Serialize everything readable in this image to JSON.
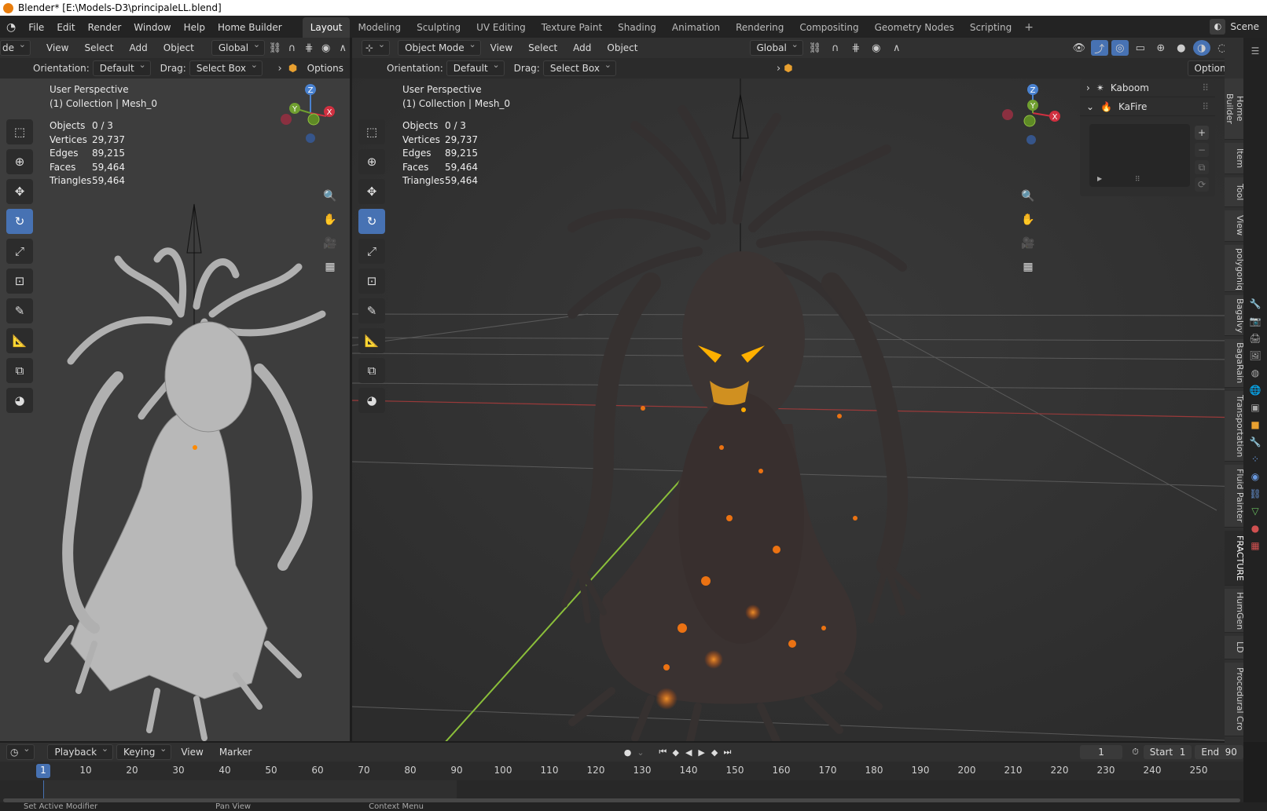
{
  "title": "Blender* [E:\\Models-D3\\principaleLL.blend]",
  "menu": [
    "File",
    "Edit",
    "Render",
    "Window",
    "Help",
    "Home Builder"
  ],
  "workspaces": [
    "Layout",
    "Modeling",
    "Sculpting",
    "UV Editing",
    "Texture Paint",
    "Shading",
    "Animation",
    "Rendering",
    "Compositing",
    "Geometry Nodes",
    "Scripting"
  ],
  "active_workspace": "Layout",
  "scene_label": "Scene",
  "left_view": {
    "mode_partial": "de",
    "menus": [
      "View",
      "Select",
      "Add",
      "Object"
    ],
    "transform": "Global",
    "orientation_label": "Orientation:",
    "orientation": "Default",
    "drag_label": "Drag:",
    "drag": "Select Box",
    "options": "Options",
    "perspective": "User Perspective",
    "collection": "(1) Collection | Mesh_0"
  },
  "right_view": {
    "mode": "Object Mode",
    "menus": [
      "View",
      "Select",
      "Add",
      "Object"
    ],
    "transform": "Global",
    "orientation_label": "Orientation:",
    "orientation": "Default",
    "drag_label": "Drag:",
    "drag": "Select Box",
    "options": "Options",
    "perspective": "User Perspective",
    "collection": "(1) Collection | Mesh_0"
  },
  "stats": [
    {
      "label": "Objects",
      "value": "0 / 3"
    },
    {
      "label": "Vertices",
      "value": "29,737"
    },
    {
      "label": "Edges",
      "value": "89,215"
    },
    {
      "label": "Faces",
      "value": "59,464"
    },
    {
      "label": "Triangles",
      "value": "59,464"
    }
  ],
  "gizmo": {
    "z": "Z",
    "y": "Y",
    "x": "X"
  },
  "npanel": {
    "kaboom": "Kaboom",
    "kafire": "KaFire"
  },
  "side_tabs": [
    "Home Builder",
    "Item",
    "Tool",
    "View",
    "polygoniq",
    "Bagalvy",
    "BagaRain",
    "Transportation",
    "Fluid Painter",
    "FRACTURE",
    "HumGen",
    "LD",
    "Procedural Cro"
  ],
  "timeline": {
    "menus": [
      "Playback",
      "Keying",
      "View",
      "Marker"
    ],
    "current_frame": "1",
    "start_label": "Start",
    "start": "1",
    "end_label": "End",
    "end": "90",
    "ticks": [
      "1",
      "10",
      "20",
      "30",
      "40",
      "50",
      "60",
      "70",
      "80",
      "90",
      "100",
      "110",
      "120",
      "130",
      "140",
      "150",
      "160",
      "170",
      "180",
      "190",
      "200",
      "210",
      "220",
      "230",
      "240",
      "250"
    ]
  },
  "status": [
    "Set Active Modifier",
    "Pan View",
    "Context Menu"
  ]
}
